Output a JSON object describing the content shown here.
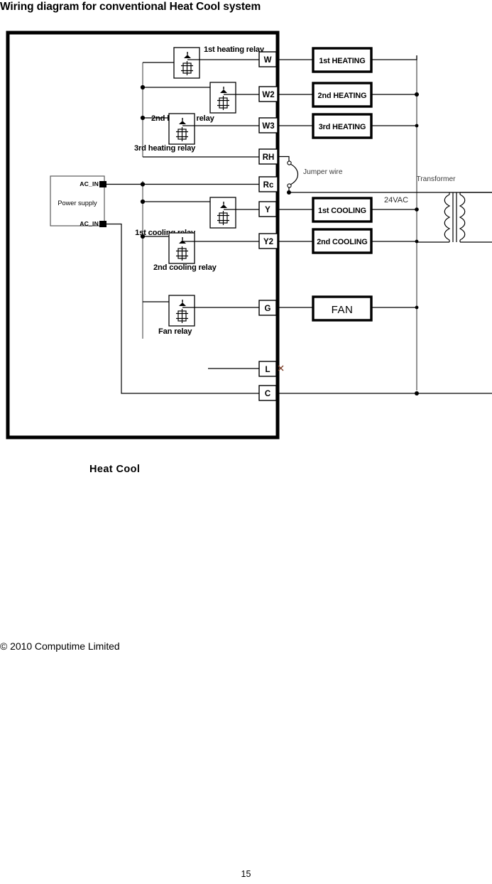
{
  "document": {
    "title": "Wiring diagram for conventional Heat Cool system",
    "caption": "Heat Cool",
    "copyright": "© 2010 Computime Limited",
    "page_number": "15"
  },
  "diagram": {
    "power_supply": {
      "label": "Power supply",
      "terminal_top": "AC_IN",
      "terminal_bottom": "AC_IN"
    },
    "relays": [
      {
        "id": "relay-1st-heating",
        "label": "1st heating relay"
      },
      {
        "id": "relay-2nd-heating",
        "label": "2nd heating relay"
      },
      {
        "id": "relay-3rd-heating",
        "label": "3rd heating relay"
      },
      {
        "id": "relay-1st-cooling",
        "label": "1st cooling relay"
      },
      {
        "id": "relay-2nd-cooling",
        "label": "2nd cooling relay"
      },
      {
        "id": "relay-fan",
        "label": "Fan relay"
      }
    ],
    "terminals": [
      {
        "id": "terminal-w",
        "label": "W"
      },
      {
        "id": "terminal-w2",
        "label": "W2"
      },
      {
        "id": "terminal-w3",
        "label": "W3"
      },
      {
        "id": "terminal-rh",
        "label": "RH"
      },
      {
        "id": "terminal-rc",
        "label": "Rc"
      },
      {
        "id": "terminal-y",
        "label": "Y"
      },
      {
        "id": "terminal-y2",
        "label": "Y2"
      },
      {
        "id": "terminal-g",
        "label": "G"
      },
      {
        "id": "terminal-l",
        "label": "L"
      },
      {
        "id": "terminal-c",
        "label": "C"
      }
    ],
    "load_boxes": [
      {
        "id": "load-1st-heating",
        "label": "1st HEATING"
      },
      {
        "id": "load-2nd-heating",
        "label": "2nd HEATING"
      },
      {
        "id": "load-3rd-heating",
        "label": "3rd HEATING"
      },
      {
        "id": "load-1st-cooling",
        "label": "1st COOLING"
      },
      {
        "id": "load-2nd-cooling",
        "label": "2nd COOLING"
      },
      {
        "id": "load-fan",
        "label": "FAN"
      }
    ],
    "annotations": {
      "jumper_wire": "Jumper wire",
      "transformer": "Transformer",
      "voltage": "24VAC"
    },
    "colors": {
      "wire": "#000000",
      "thin_wire": "#595959",
      "frame": "#000000",
      "cross_mark": "#7a3b25"
    }
  }
}
